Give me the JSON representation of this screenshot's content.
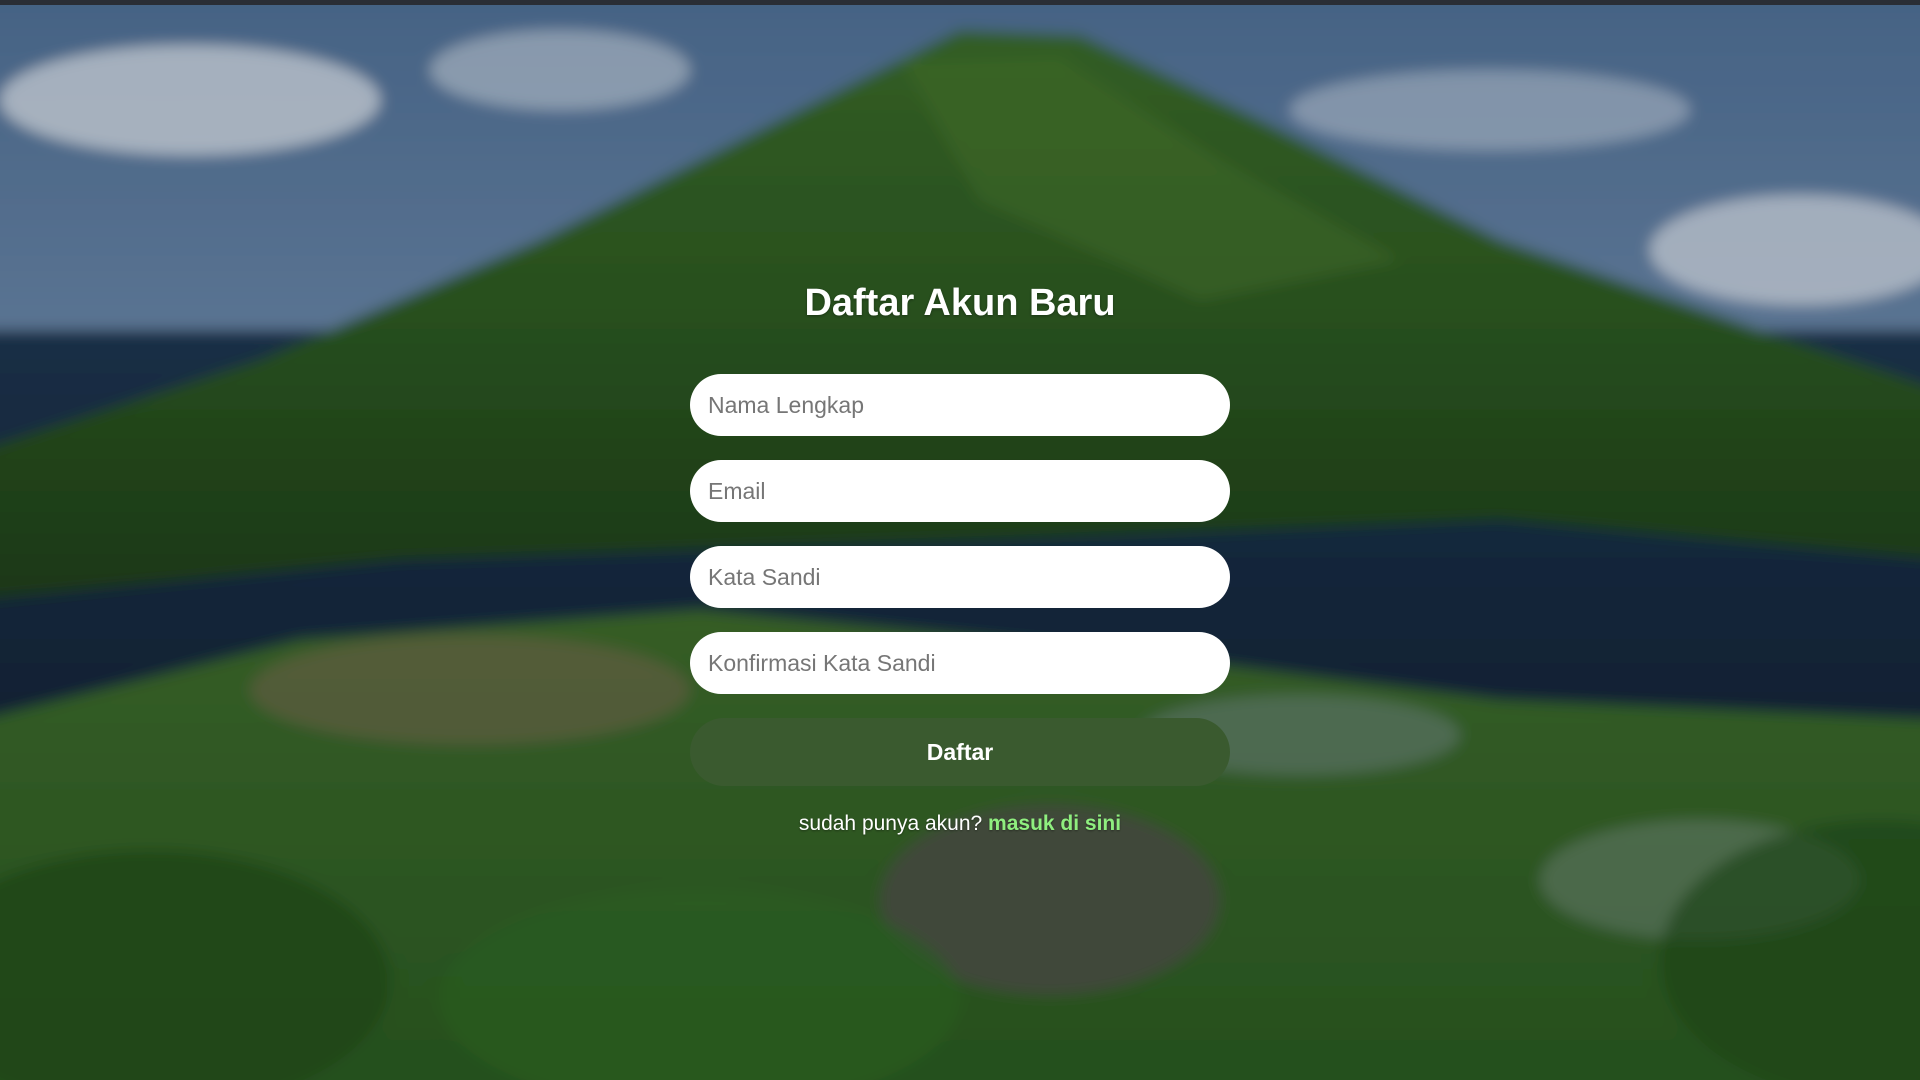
{
  "register": {
    "title": "Daftar Akun Baru",
    "fields": [
      {
        "placeholder": "Nama Lengkap"
      },
      {
        "placeholder": "Email"
      },
      {
        "placeholder": "Kata Sandi"
      },
      {
        "placeholder": "Konfirmasi Kata Sandi"
      }
    ],
    "submit_label": "Daftar",
    "login_prompt": "sudah punya akun? ",
    "login_link": "masuk di sini"
  },
  "colors": {
    "button": "#3a5a2f",
    "link": "#8fef7f"
  }
}
